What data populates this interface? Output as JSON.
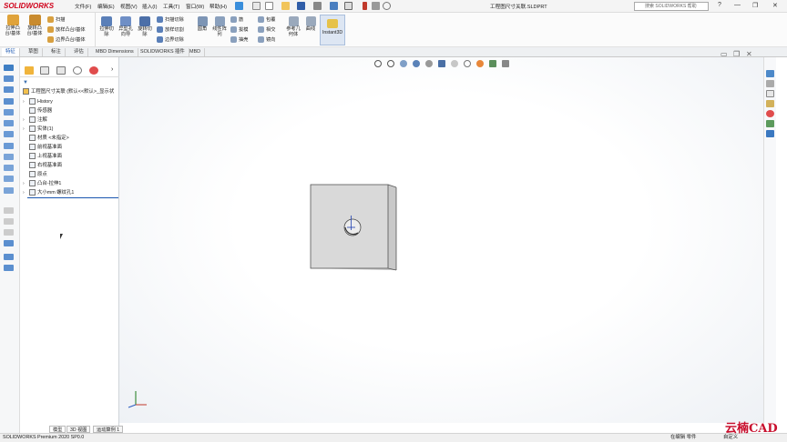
{
  "app": {
    "logo": "SOLIDWORKS",
    "document_title": "工程图尺寸关联.SLDPRT"
  },
  "menu": [
    "文件(F)",
    "编辑(E)",
    "视图(V)",
    "插入(I)",
    "工具(T)",
    "窗口(W)",
    "帮助(H)"
  ],
  "search": {
    "placeholder": "搜索 SOLIDWORKS 帮助"
  },
  "window_controls": [
    "?",
    "—",
    "❐",
    "✕"
  ],
  "ribbon": {
    "large_buttons": [
      {
        "label": "拉伸凸台/基体",
        "icon": "extrude-boss-icon"
      },
      {
        "label": "旋转凸台/基体",
        "icon": "revolve-boss-icon"
      },
      {
        "label": "拉伸切除",
        "icon": "extrude-cut-icon"
      },
      {
        "label": "异型孔向导",
        "icon": "hole-wizard-icon"
      },
      {
        "label": "旋转切除",
        "icon": "revolve-cut-icon"
      },
      {
        "label": "圆角",
        "icon": "fillet-icon"
      },
      {
        "label": "线性阵列",
        "icon": "linear-pattern-icon"
      },
      {
        "label": "参考几何体",
        "icon": "reference-geometry-icon"
      },
      {
        "label": "曲线",
        "icon": "curves-icon"
      },
      {
        "label": "Instant3D",
        "icon": "instant3d-icon"
      }
    ],
    "small_buttons_col1": [
      "扫描",
      "放样凸台/基体",
      "边界凸台/基体"
    ],
    "small_buttons_col2": [
      "扫描切除",
      "放样切割",
      "边界切除"
    ],
    "small_buttons_col3": [
      "筋",
      "拔模",
      "抽壳"
    ],
    "small_buttons_col4": [
      "包覆",
      "相交",
      "镜向"
    ]
  },
  "tabs": [
    "特征",
    "草图",
    "标注",
    "评估",
    "MBD Dimensions",
    "SOLIDWORKS 插件",
    "MBD"
  ],
  "feature_tree": {
    "root": "工程图尺寸关联 (默认<<默认>_显示状",
    "items": [
      {
        "label": "History",
        "icon": "history-icon",
        "expandable": true
      },
      {
        "label": "传感器",
        "icon": "sensor-icon",
        "expandable": false
      },
      {
        "label": "注解",
        "icon": "annotations-icon",
        "expandable": true
      },
      {
        "label": "实体(1)",
        "icon": "solid-bodies-icon",
        "expandable": true
      },
      {
        "label": "材质 <未指定>",
        "icon": "material-icon",
        "expandable": false
      },
      {
        "label": "前视基准面",
        "icon": "plane-icon",
        "expandable": false
      },
      {
        "label": "上视基准面",
        "icon": "plane-icon",
        "expandable": false
      },
      {
        "label": "右视基准面",
        "icon": "plane-icon",
        "expandable": false
      },
      {
        "label": "原点",
        "icon": "origin-icon",
        "expandable": false
      },
      {
        "label": "凸台-拉伸1",
        "icon": "boss-extrude-icon",
        "expandable": true
      },
      {
        "label": "大小mm 螺纹孔1",
        "icon": "hole-icon",
        "expandable": true
      }
    ]
  },
  "bottom_tabs": [
    "模型",
    "3D 视图",
    "运动算例 1"
  ],
  "status": {
    "left": "SOLIDWORKS Premium 2020 SP0.0",
    "edit_mode": "在编辑 零件",
    "units": "自定义"
  },
  "watermark": "云楠CAD",
  "colors": {
    "accent": "#1a56b0",
    "part_face": "#d9d9d9",
    "logo": "#d0021b"
  }
}
